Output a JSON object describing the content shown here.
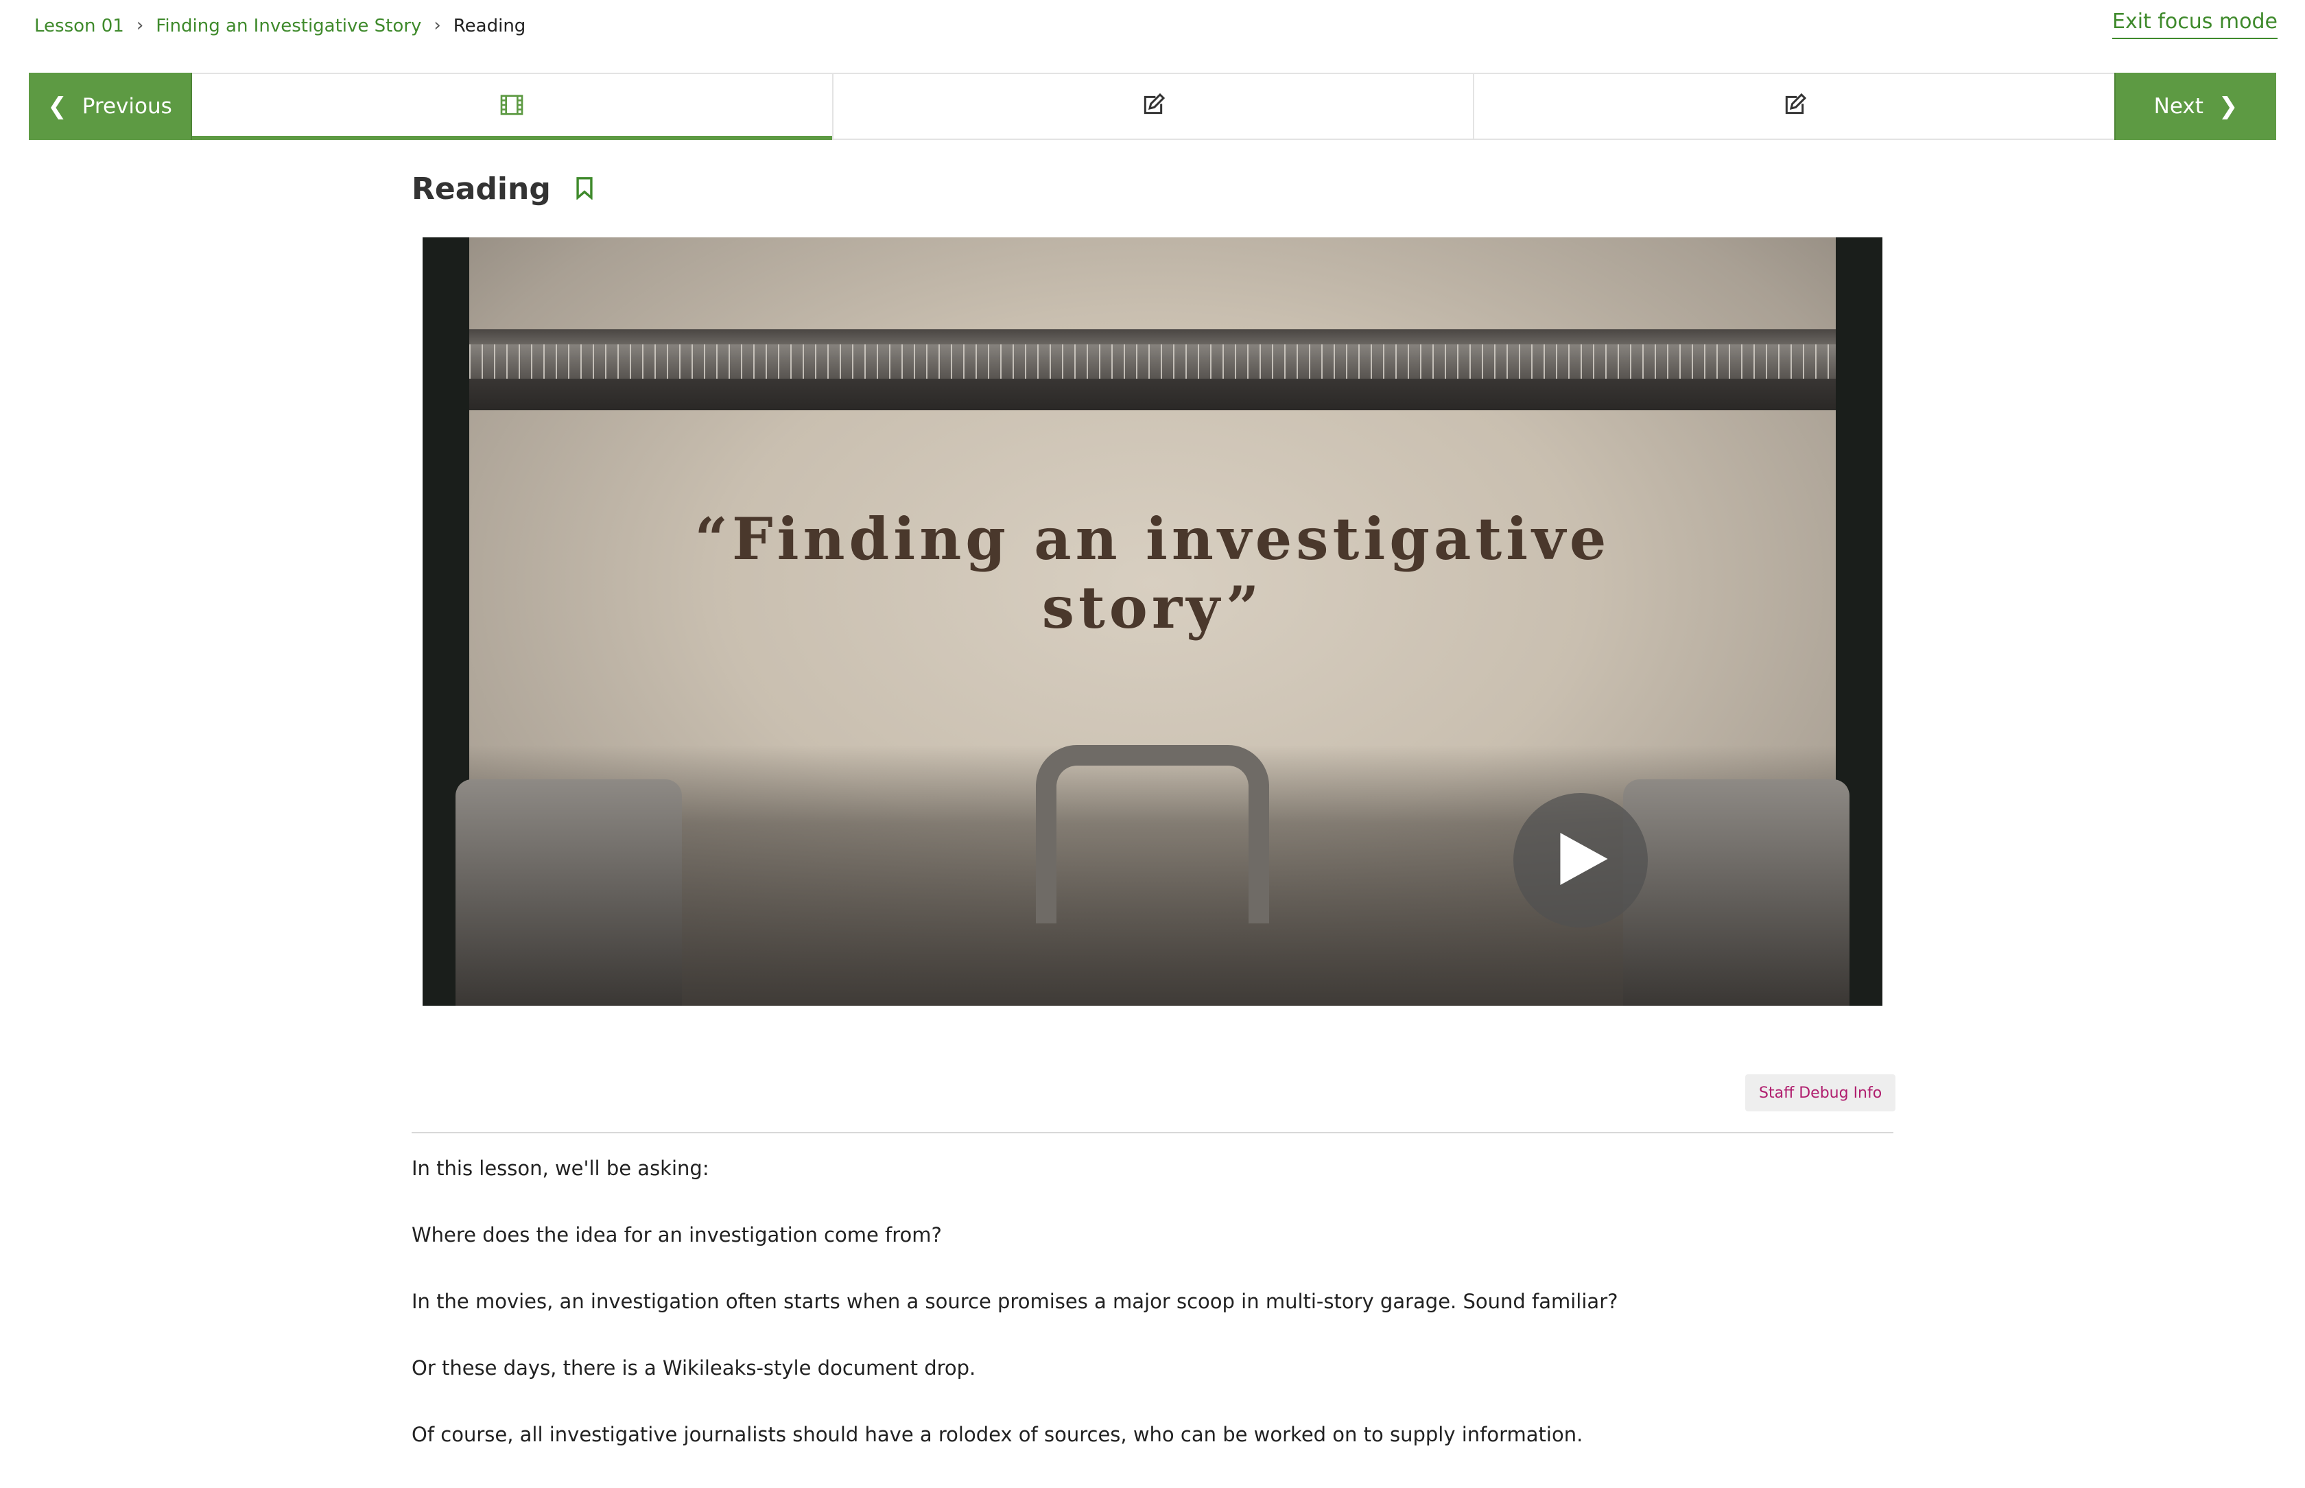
{
  "breadcrumb": {
    "items": [
      "Lesson 01",
      "Finding an Investigative Story"
    ],
    "current": "Reading"
  },
  "header": {
    "exit_focus_label": "Exit focus mode"
  },
  "sequence_nav": {
    "previous_label": "Previous",
    "next_label": "Next",
    "tabs": [
      {
        "icon": "film-icon",
        "active": true
      },
      {
        "icon": "edit-icon",
        "active": false
      },
      {
        "icon": "edit-icon",
        "active": false
      }
    ]
  },
  "unit": {
    "title": "Reading"
  },
  "video": {
    "typed_line1": "“Finding an investigative",
    "typed_line2": "story”"
  },
  "debug": {
    "label": "Staff Debug Info"
  },
  "content": {
    "paragraphs": [
      "In this lesson, we'll be asking:",
      "Where does the idea for an investigation come from?",
      "In the movies, an investigation often starts when a source promises a major scoop in multi-story garage. Sound familiar?",
      "Or these days, there is a Wikileaks-style document drop.",
      "Of course, all investigative journalists should have a rolodex of sources, who can be worked on to supply information."
    ]
  },
  "colors": {
    "accent": "#5d9a43",
    "link": "#3f8a2c",
    "debug_text": "#b01e6e"
  }
}
